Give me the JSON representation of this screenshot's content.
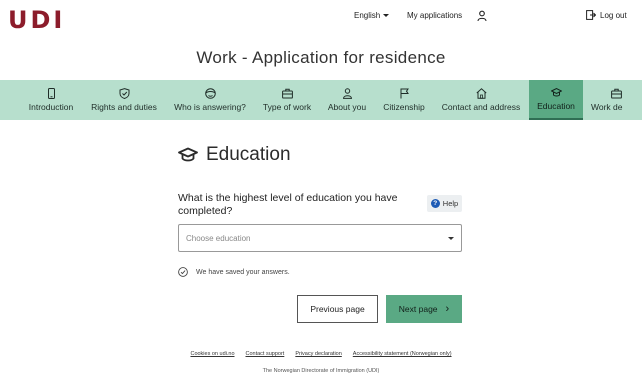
{
  "header": {
    "logo": "UDI",
    "language": "English",
    "my_applications": "My applications",
    "logout": "Log out"
  },
  "page_title": "Work - Application for residence",
  "steps": [
    {
      "label": "Introduction",
      "icon": "phone-icon"
    },
    {
      "label": "Rights and duties",
      "icon": "shield-check-icon"
    },
    {
      "label": "Who is answering?",
      "icon": "face-icon"
    },
    {
      "label": "Type of work",
      "icon": "briefcase-icon"
    },
    {
      "label": "About you",
      "icon": "person-icon"
    },
    {
      "label": "Citizenship",
      "icon": "flag-icon"
    },
    {
      "label": "Contact and address",
      "icon": "house-icon"
    },
    {
      "label": "Education",
      "icon": "graduation-cap-icon",
      "active": true
    },
    {
      "label": "Work de",
      "icon": "briefcase-icon"
    }
  ],
  "section": {
    "heading": "Education",
    "question": "What is the highest level of education you have completed?",
    "help_label": "Help",
    "select_placeholder": "Choose education",
    "saved_text": "We have saved your answers."
  },
  "buttons": {
    "previous": "Previous page",
    "next": "Next page"
  },
  "footer": {
    "links": [
      "Cookies on udi.no",
      "Contact support",
      "Privacy declaration",
      "Accessibility statement (Norwegian only)"
    ],
    "org": "The Norwegian Directorate of Immigration (UDI)"
  },
  "colors": {
    "brand": "#8c1c2b",
    "steps_bg": "#b7dfcd",
    "accent": "#5aa984"
  }
}
